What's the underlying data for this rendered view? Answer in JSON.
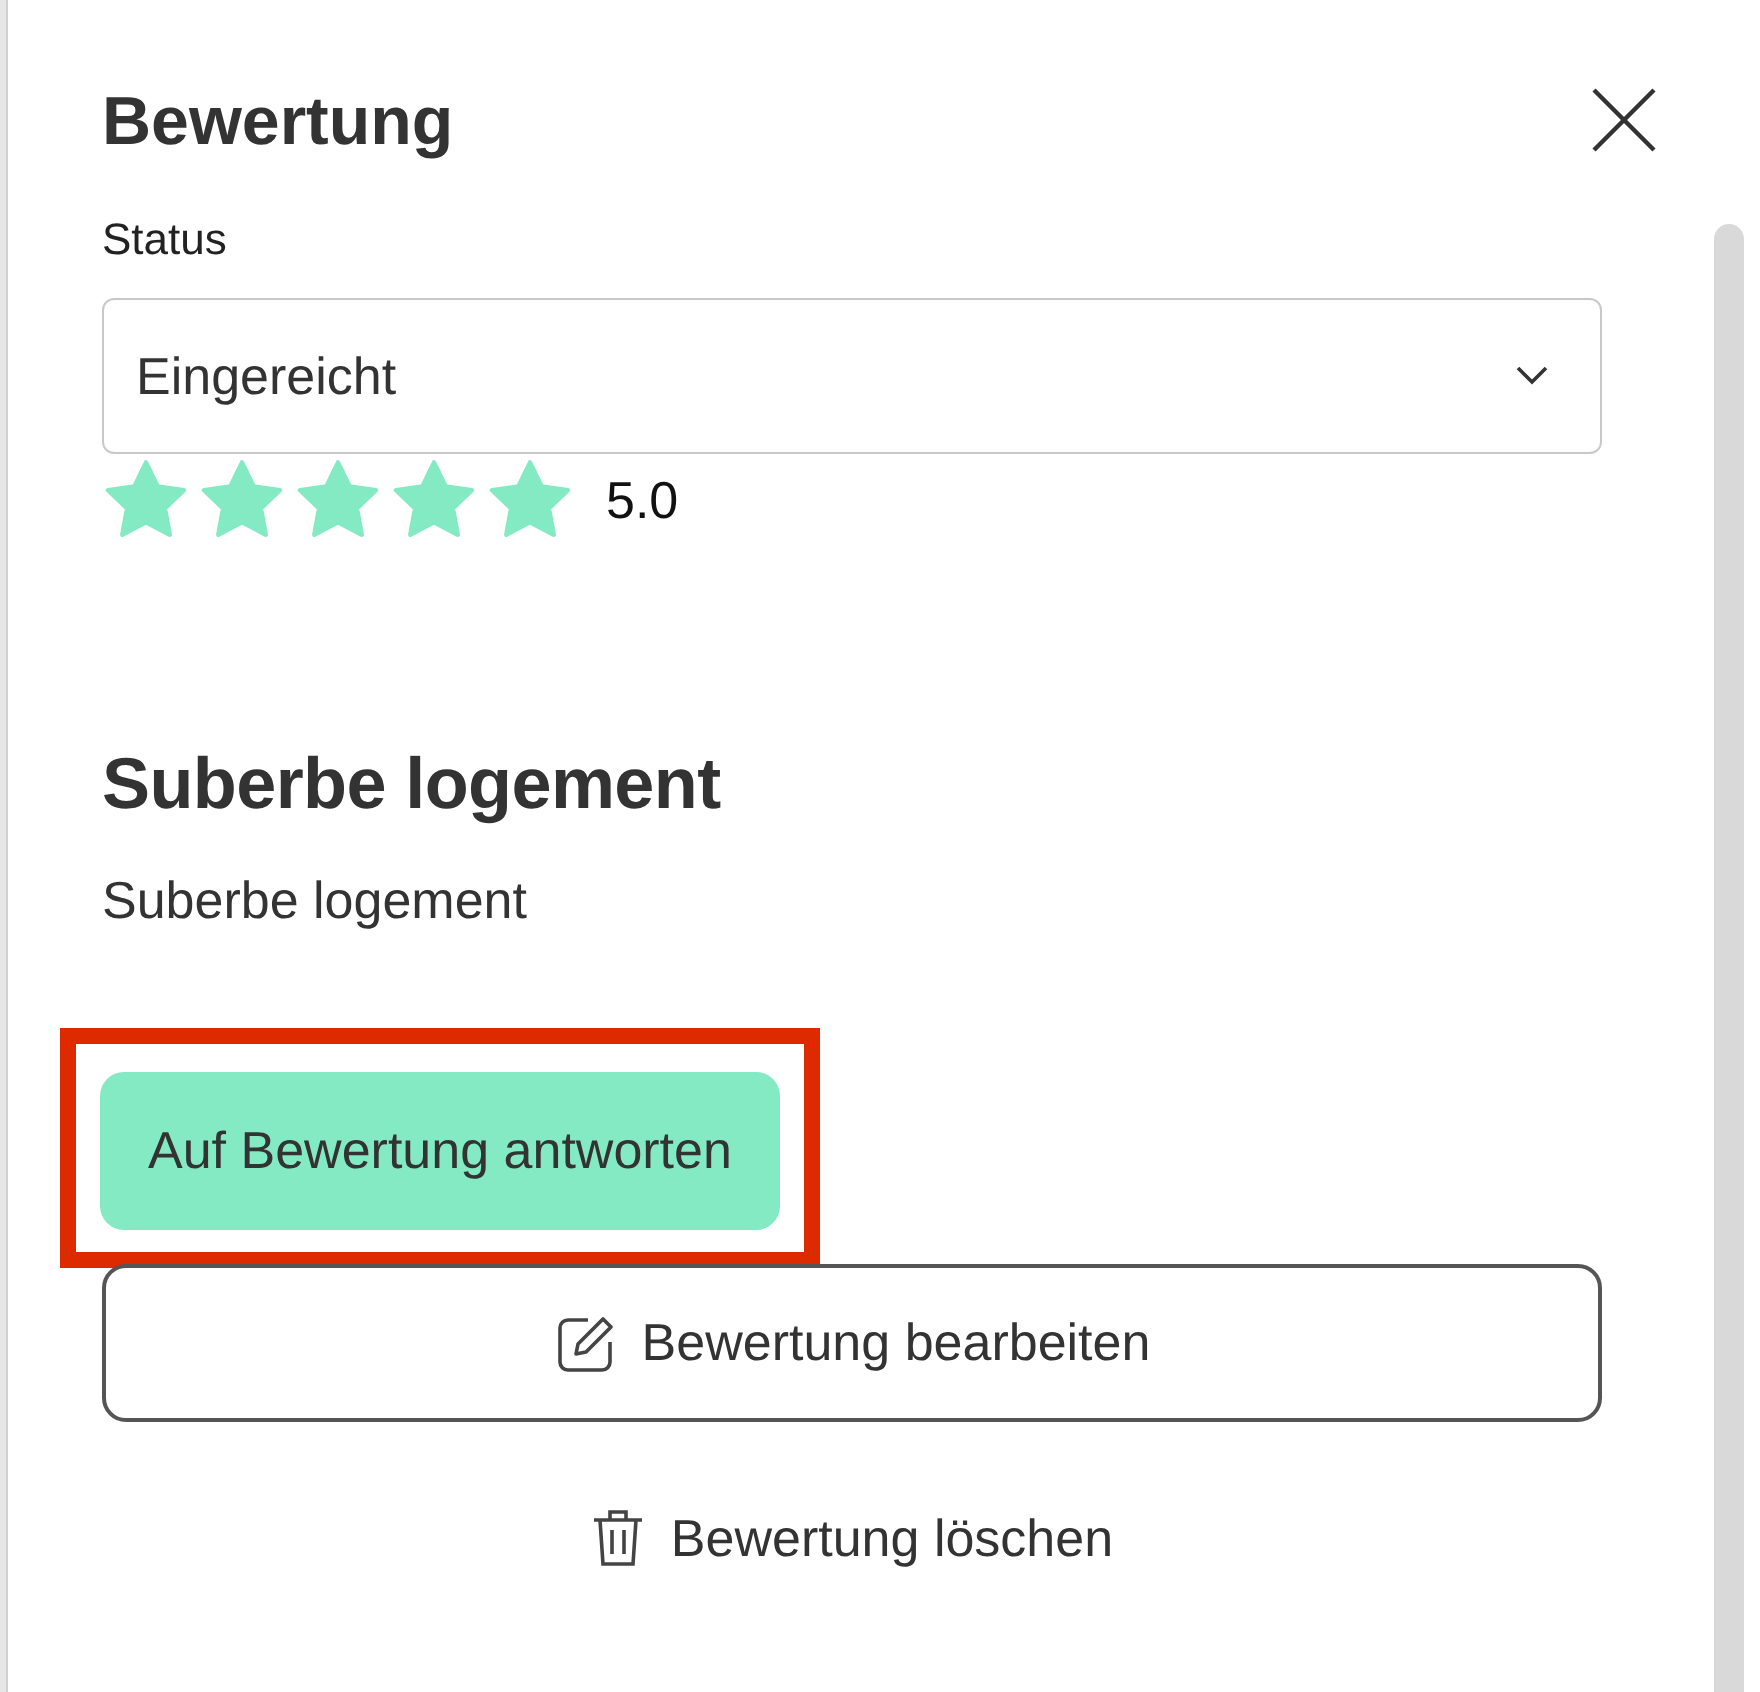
{
  "title": "Bewertung",
  "status": {
    "label": "Status",
    "value": "Eingereicht"
  },
  "rating": {
    "stars": 5,
    "score": "5.0"
  },
  "review": {
    "title": "Suberbe logement",
    "text": "Suberbe logement"
  },
  "buttons": [
    {
      "kind": "primary",
      "label": "Auf Bewertung antworten",
      "highlighted": true
    },
    {
      "kind": "outline",
      "label": "Bewertung bearbeiten",
      "highlighted": false
    },
    {
      "kind": "text",
      "label": "Bewertung löschen",
      "highlighted": false
    }
  ]
}
